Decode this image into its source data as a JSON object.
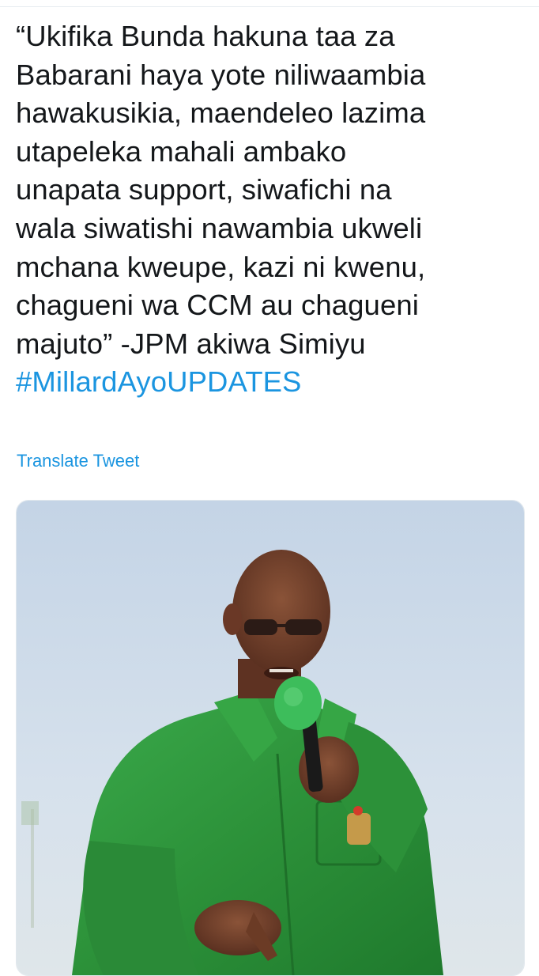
{
  "tweet": {
    "lines": [
      "“Ukifika Bunda hakuna taa za",
      "Babarani haya yote niliwaambia",
      "hawakusikia, maendeleo lazima",
      "utapeleka mahali ambako",
      "unapata support, siwafichi na",
      "wala siwatishi nawambia ukweli",
      "mchana kweupe, kazi ni kwenu,",
      "chagueni wa CCM au chagueni",
      "majuto” -JPM akiwa Simiyu"
    ],
    "hashtag": "#MillardAyoUPDATES",
    "translate_label": "Translate Tweet"
  },
  "colors": {
    "text": "#14171a",
    "link": "#1b95e0",
    "shirt_green": "#2f9c3c",
    "mic_green": "#3dbd5b",
    "sky": "#c9d8e8"
  },
  "media": {
    "image_icon": "photo-of-speaker-with-microphone"
  }
}
